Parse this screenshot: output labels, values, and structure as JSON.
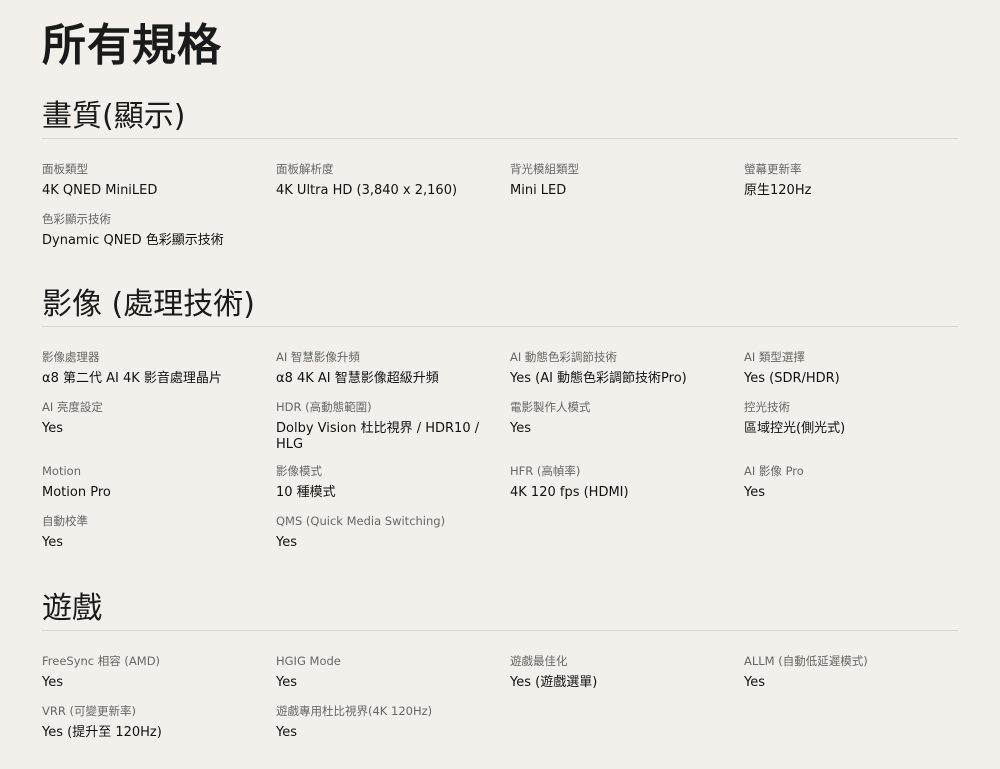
{
  "page_title": "所有規格",
  "sections": [
    {
      "title": "畫質(顯示)",
      "specs": [
        {
          "label": "面板類型",
          "value": "4K QNED MiniLED"
        },
        {
          "label": "面板解析度",
          "value": "4K Ultra HD (3,840 x 2,160)"
        },
        {
          "label": "背光模組類型",
          "value": "Mini LED"
        },
        {
          "label": "螢幕更新率",
          "value": "原生120Hz"
        },
        {
          "label": "色彩顯示技術",
          "value": "Dynamic QNED 色彩顯示技術"
        }
      ]
    },
    {
      "title": "影像 (處理技術)",
      "specs": [
        {
          "label": "影像處理器",
          "value": "α8 第二代 AI 4K 影音處理晶片"
        },
        {
          "label": "AI 智慧影像升頻",
          "value": "α8 4K AI 智慧影像超級升頻"
        },
        {
          "label": "AI 動態色彩調節技術",
          "value": "Yes (AI 動態色彩調節技術Pro)"
        },
        {
          "label": "AI 類型選擇",
          "value": "Yes (SDR/HDR)"
        },
        {
          "label": "AI 亮度設定",
          "value": "Yes"
        },
        {
          "label": "HDR (高動態範圍)",
          "value": "Dolby Vision 杜比視界 / HDR10 / HLG"
        },
        {
          "label": "電影製作人模式",
          "value": "Yes"
        },
        {
          "label": "控光技術",
          "value": "區域控光(側光式)"
        },
        {
          "label": "Motion",
          "value": "Motion Pro"
        },
        {
          "label": "影像模式",
          "value": "10 種模式"
        },
        {
          "label": "HFR (高幀率)",
          "value": "4K 120 fps (HDMI)"
        },
        {
          "label": "AI 影像 Pro",
          "value": "Yes"
        },
        {
          "label": "自動校準",
          "value": "Yes"
        },
        {
          "label": "QMS (Quick Media Switching)",
          "value": "Yes"
        }
      ]
    },
    {
      "title": "遊戲",
      "specs": [
        {
          "label": "FreeSync 相容 (AMD)",
          "value": "Yes"
        },
        {
          "label": "HGIG Mode",
          "value": "Yes"
        },
        {
          "label": "遊戲最佳化",
          "value": "Yes (遊戲選單)"
        },
        {
          "label": "ALLM (自動低延遲模式)",
          "value": "Yes"
        },
        {
          "label": "VRR (可變更新率)",
          "value": "Yes (提升至 120Hz)"
        },
        {
          "label": "遊戲專用杜比視界(4K 120Hz)",
          "value": "Yes"
        }
      ]
    }
  ]
}
